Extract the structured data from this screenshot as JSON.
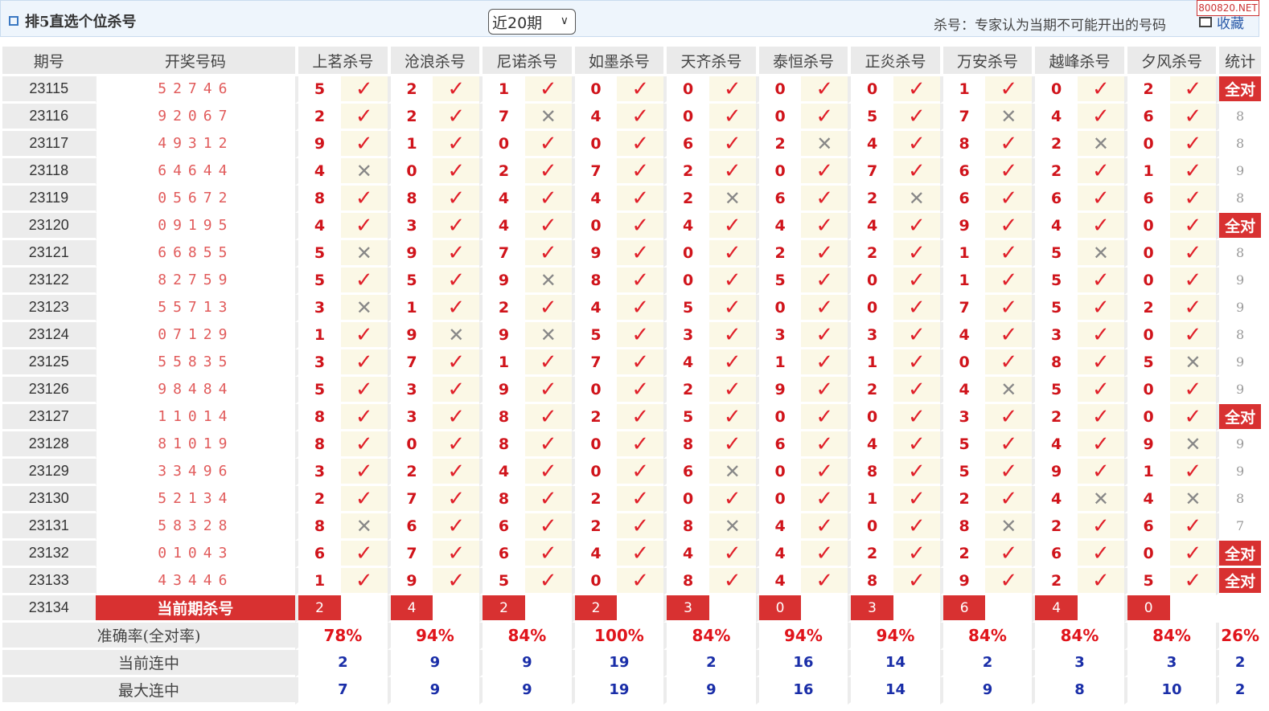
{
  "header": {
    "title": "排5直选个位杀号",
    "period_select": "近20期",
    "hint": "杀号：专家认为当期不可能开出的号码",
    "favorite": "收藏",
    "watermark": "800820.NET"
  },
  "columns": {
    "issue": "期号",
    "draw": "开奖号码",
    "experts": [
      "上茗杀号",
      "沧浪杀号",
      "尼诺杀号",
      "如墨杀号",
      "天齐杀号",
      "泰恒杀号",
      "正炎杀号",
      "万安杀号",
      "越峰杀号",
      "夕风杀号"
    ],
    "stat": "统计"
  },
  "marks": {
    "ok": "✓",
    "no": "✕"
  },
  "rows": [
    {
      "issue": "23115",
      "draw": "52746",
      "kills": [
        5,
        2,
        1,
        0,
        0,
        0,
        0,
        1,
        0,
        2
      ],
      "hits": [
        1,
        1,
        1,
        1,
        1,
        1,
        1,
        1,
        1,
        1
      ],
      "stat": "全对"
    },
    {
      "issue": "23116",
      "draw": "92067",
      "kills": [
        2,
        2,
        7,
        4,
        0,
        0,
        5,
        7,
        4,
        6
      ],
      "hits": [
        1,
        1,
        0,
        1,
        1,
        1,
        1,
        0,
        1,
        1
      ],
      "stat": "8"
    },
    {
      "issue": "23117",
      "draw": "49312",
      "kills": [
        9,
        1,
        0,
        0,
        6,
        2,
        4,
        8,
        2,
        0
      ],
      "hits": [
        1,
        1,
        1,
        1,
        1,
        0,
        1,
        1,
        0,
        1
      ],
      "stat": "8"
    },
    {
      "issue": "23118",
      "draw": "64644",
      "kills": [
        4,
        0,
        2,
        7,
        2,
        0,
        7,
        6,
        2,
        1
      ],
      "hits": [
        0,
        1,
        1,
        1,
        1,
        1,
        1,
        1,
        1,
        1
      ],
      "stat": "9"
    },
    {
      "issue": "23119",
      "draw": "05672",
      "kills": [
        8,
        8,
        4,
        4,
        2,
        6,
        2,
        6,
        6,
        6
      ],
      "hits": [
        1,
        1,
        1,
        1,
        0,
        1,
        0,
        1,
        1,
        1
      ],
      "stat": "8"
    },
    {
      "issue": "23120",
      "draw": "09195",
      "kills": [
        4,
        3,
        4,
        0,
        4,
        4,
        4,
        9,
        4,
        0
      ],
      "hits": [
        1,
        1,
        1,
        1,
        1,
        1,
        1,
        1,
        1,
        1
      ],
      "stat": "全对"
    },
    {
      "issue": "23121",
      "draw": "66855",
      "kills": [
        5,
        9,
        7,
        9,
        0,
        2,
        2,
        1,
        5,
        0
      ],
      "hits": [
        0,
        1,
        1,
        1,
        1,
        1,
        1,
        1,
        0,
        1
      ],
      "stat": "8"
    },
    {
      "issue": "23122",
      "draw": "82759",
      "kills": [
        5,
        5,
        9,
        8,
        0,
        5,
        0,
        1,
        5,
        0
      ],
      "hits": [
        1,
        1,
        0,
        1,
        1,
        1,
        1,
        1,
        1,
        1
      ],
      "stat": "9"
    },
    {
      "issue": "23123",
      "draw": "55713",
      "kills": [
        3,
        1,
        2,
        4,
        5,
        0,
        0,
        7,
        5,
        2
      ],
      "hits": [
        0,
        1,
        1,
        1,
        1,
        1,
        1,
        1,
        1,
        1
      ],
      "stat": "9"
    },
    {
      "issue": "23124",
      "draw": "07129",
      "kills": [
        1,
        9,
        9,
        5,
        3,
        3,
        3,
        4,
        3,
        0
      ],
      "hits": [
        1,
        0,
        0,
        1,
        1,
        1,
        1,
        1,
        1,
        1
      ],
      "stat": "8"
    },
    {
      "issue": "23125",
      "draw": "55835",
      "kills": [
        3,
        7,
        1,
        7,
        4,
        1,
        1,
        0,
        8,
        5
      ],
      "hits": [
        1,
        1,
        1,
        1,
        1,
        1,
        1,
        1,
        1,
        0
      ],
      "stat": "9"
    },
    {
      "issue": "23126",
      "draw": "98484",
      "kills": [
        5,
        3,
        9,
        0,
        2,
        9,
        2,
        4,
        5,
        0
      ],
      "hits": [
        1,
        1,
        1,
        1,
        1,
        1,
        1,
        0,
        1,
        1
      ],
      "stat": "9"
    },
    {
      "issue": "23127",
      "draw": "11014",
      "kills": [
        8,
        3,
        8,
        2,
        5,
        0,
        0,
        3,
        2,
        0
      ],
      "hits": [
        1,
        1,
        1,
        1,
        1,
        1,
        1,
        1,
        1,
        1
      ],
      "stat": "全对"
    },
    {
      "issue": "23128",
      "draw": "81019",
      "kills": [
        8,
        0,
        8,
        0,
        8,
        6,
        4,
        5,
        4,
        9
      ],
      "hits": [
        1,
        1,
        1,
        1,
        1,
        1,
        1,
        1,
        1,
        0
      ],
      "stat": "9"
    },
    {
      "issue": "23129",
      "draw": "33496",
      "kills": [
        3,
        2,
        4,
        0,
        6,
        0,
        8,
        5,
        9,
        1
      ],
      "hits": [
        1,
        1,
        1,
        1,
        0,
        1,
        1,
        1,
        1,
        1
      ],
      "stat": "9"
    },
    {
      "issue": "23130",
      "draw": "52134",
      "kills": [
        2,
        7,
        8,
        2,
        0,
        0,
        1,
        2,
        4,
        4
      ],
      "hits": [
        1,
        1,
        1,
        1,
        1,
        1,
        1,
        1,
        0,
        0
      ],
      "stat": "8"
    },
    {
      "issue": "23131",
      "draw": "58328",
      "kills": [
        8,
        6,
        6,
        2,
        8,
        4,
        0,
        8,
        2,
        6
      ],
      "hits": [
        0,
        1,
        1,
        1,
        0,
        1,
        1,
        0,
        1,
        1
      ],
      "stat": "7"
    },
    {
      "issue": "23132",
      "draw": "01043",
      "kills": [
        6,
        7,
        6,
        4,
        4,
        4,
        2,
        2,
        6,
        0
      ],
      "hits": [
        1,
        1,
        1,
        1,
        1,
        1,
        1,
        1,
        1,
        1
      ],
      "stat": "全对"
    },
    {
      "issue": "23133",
      "draw": "43446",
      "kills": [
        1,
        9,
        5,
        0,
        8,
        4,
        8,
        9,
        2,
        5
      ],
      "hits": [
        1,
        1,
        1,
        1,
        1,
        1,
        1,
        1,
        1,
        1
      ],
      "stat": "全对"
    }
  ],
  "current": {
    "issue": "23134",
    "label": "当前期杀号",
    "kills": [
      "2",
      "4",
      "2",
      "2",
      "3",
      "0",
      "3",
      "6",
      "4",
      "0"
    ]
  },
  "summary": {
    "accuracy_label": "准确率(全对率)",
    "accuracy": [
      "78%",
      "94%",
      "84%",
      "100%",
      "84%",
      "94%",
      "94%",
      "84%",
      "84%",
      "84%"
    ],
    "accuracy_total": "26%",
    "streak_label": "当前连中",
    "streak": [
      "2",
      "9",
      "9",
      "19",
      "2",
      "16",
      "14",
      "2",
      "3",
      "3"
    ],
    "streak_total": "2",
    "max_label": "最大连中",
    "max": [
      "7",
      "9",
      "9",
      "19",
      "9",
      "16",
      "14",
      "9",
      "8",
      "10"
    ],
    "max_total": "2"
  }
}
